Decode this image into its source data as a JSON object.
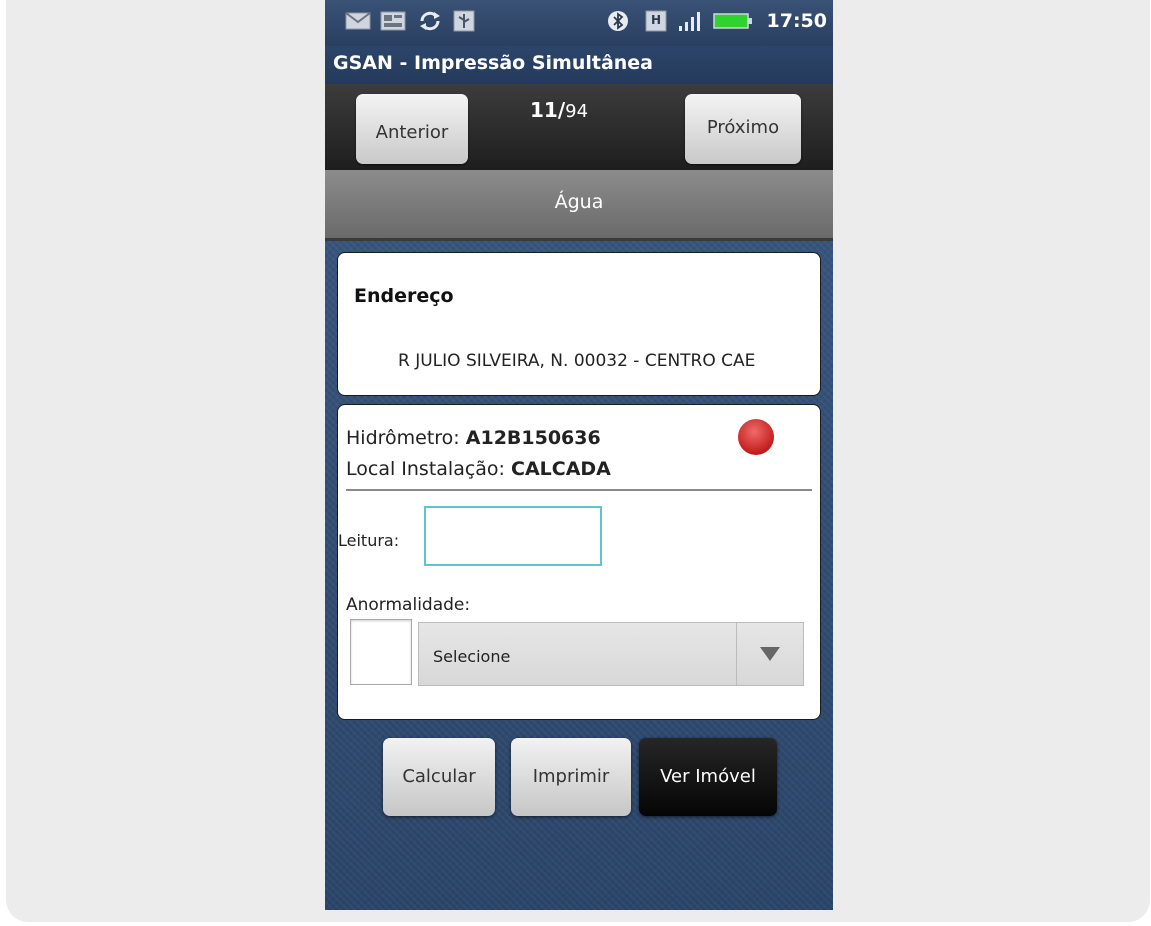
{
  "status_bar": {
    "time": "17:50",
    "icons": [
      "mail-icon",
      "gallery-icon",
      "sync-icon",
      "usb-icon",
      "bluetooth-icon",
      "h-network-icon",
      "signal-icon",
      "battery-icon"
    ]
  },
  "app": {
    "title": "GSAN - Impressão Simultânea"
  },
  "nav": {
    "prev_label": "Anterior",
    "next_label": "Próximo",
    "current": "11/",
    "total": "94"
  },
  "tab": {
    "label": "Água"
  },
  "address": {
    "title": "Endereço",
    "text": "R JULIO SILVEIRA, N. 00032 - CENTRO CAE"
  },
  "meter": {
    "hidrometro_label": "Hidrômetro: ",
    "hidrometro_value": "A12B150636",
    "local_label": "Local Instalação: ",
    "local_value": "CALCADA",
    "status_color": "#d42a2a"
  },
  "form": {
    "leitura_label": "Leitura:",
    "leitura_value": "",
    "anormalidade_label": "Anormalidade:",
    "anormalidade_code": "",
    "anormalidade_selected": "Selecione"
  },
  "actions": {
    "calcular": "Calcular",
    "imprimir": "Imprimir",
    "ver_imovel": "Ver Imóvel"
  },
  "colors": {
    "background_blue": "#2f4a73",
    "input_focus": "#60c4cf",
    "dark_button": "#0a0a0a"
  }
}
